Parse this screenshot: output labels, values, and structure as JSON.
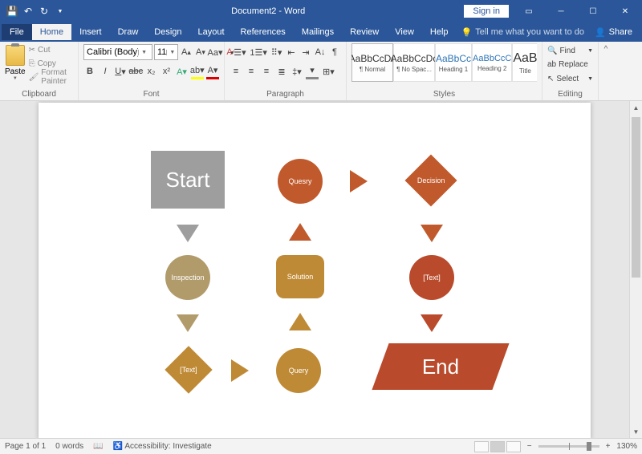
{
  "title": "Document2 - Word",
  "signin": "Sign in",
  "menu": {
    "file": "File",
    "home": "Home",
    "insert": "Insert",
    "draw": "Draw",
    "design": "Design",
    "layout": "Layout",
    "references": "References",
    "mailings": "Mailings",
    "review": "Review",
    "view": "View",
    "help": "Help"
  },
  "tellme": "Tell me what you want to do",
  "share": "Share",
  "clipboard": {
    "paste": "Paste",
    "cut": "Cut",
    "copy": "Copy",
    "format_painter": "Format Painter",
    "label": "Clipboard"
  },
  "font": {
    "family": "Calibri (Body)",
    "size": "11",
    "label": "Font"
  },
  "paragraph": {
    "label": "Paragraph"
  },
  "styles": {
    "label": "Styles",
    "items": [
      {
        "preview": "AaBbCcDc",
        "name": "¶ Normal"
      },
      {
        "preview": "AaBbCcDc",
        "name": "¶ No Spac..."
      },
      {
        "preview": "AaBbCc",
        "name": "Heading 1"
      },
      {
        "preview": "AaBbCcC",
        "name": "Heading 2"
      },
      {
        "preview": "AaB",
        "name": "Title"
      }
    ]
  },
  "editing": {
    "find": "Find",
    "replace": "Replace",
    "select": "Select",
    "label": "Editing"
  },
  "status": {
    "page": "Page 1 of 1",
    "words": "0 words",
    "accessibility": "Accessibility: Investigate",
    "zoom": "130%"
  },
  "shapes": {
    "start": "Start",
    "quesry": "Quesry",
    "decision": "Decision",
    "inspection": "Inspection",
    "solution": "Solution",
    "text": "[Text]",
    "query": "Query",
    "end": "End"
  },
  "colors": {
    "gray": "#9e9e9e",
    "rust": "#c05a2c",
    "brown": "#bf8a36",
    "tan": "#b19b6b",
    "darkred": "#b94a2c"
  }
}
